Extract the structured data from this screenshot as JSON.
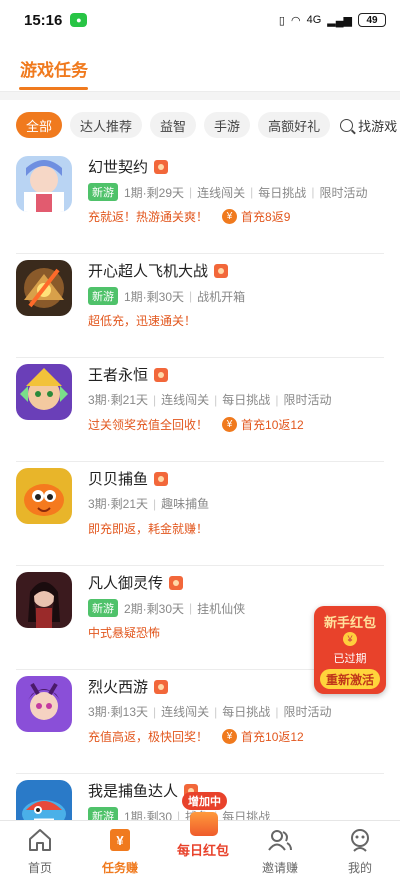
{
  "status_bar": {
    "time": "15:16",
    "wechat_icon": "wechat-icon",
    "network": "4G",
    "battery": "49"
  },
  "header": {
    "title": "游戏任务"
  },
  "filters": {
    "chips": [
      "全部",
      "达人推荐",
      "益智",
      "手游",
      "高额好礼"
    ],
    "active_index": 0,
    "search_label": "找游戏"
  },
  "games": [
    {
      "name": "幻世契约",
      "is_new": true,
      "new_label": "新游",
      "period": "1期·剩29天",
      "tags": [
        "连线闯关",
        "每日挑战",
        "限时活动"
      ],
      "promo": "充就返！热游通关爽！",
      "first_charge": "首充8返9"
    },
    {
      "name": "开心超人飞机大战",
      "is_new": true,
      "new_label": "新游",
      "period": "1期·剩30天",
      "tags": [
        "战机开箱"
      ],
      "promo": "超低充，迅速通关！",
      "first_charge": ""
    },
    {
      "name": "王者永恒",
      "is_new": false,
      "new_label": "",
      "period": "3期·剩21天",
      "tags": [
        "连线闯关",
        "每日挑战",
        "限时活动"
      ],
      "promo": "过关领奖充值全回收！",
      "first_charge": "首充10返12"
    },
    {
      "name": "贝贝捕鱼",
      "is_new": false,
      "new_label": "",
      "period": "3期·剩21天",
      "tags": [
        "趣味捕鱼"
      ],
      "promo": "即充即返，耗金就赚！",
      "first_charge": ""
    },
    {
      "name": "凡人御灵传",
      "is_new": true,
      "new_label": "新游",
      "period": "2期·剩30天",
      "tags": [
        "挂机仙侠"
      ],
      "promo": "中式悬疑恐怖",
      "first_charge": ""
    },
    {
      "name": "烈火西游",
      "is_new": false,
      "new_label": "",
      "period": "3期·剩13天",
      "tags": [
        "连线闯关",
        "每日挑战",
        "限时活动"
      ],
      "promo": "充值高返，极快回奖！",
      "first_charge": "首充10返12"
    },
    {
      "name": "我是捕鱼达人",
      "is_new": true,
      "new_label": "新游",
      "period": "1期·剩30",
      "tags": [
        "捕鱼",
        "每日挑战"
      ],
      "promo": "",
      "first_charge": ""
    }
  ],
  "redpacket": {
    "title": "新手红包",
    "status": "已过期",
    "button": "重新激活"
  },
  "tabbar": {
    "tabs": [
      {
        "label": "首页",
        "icon": "home-icon"
      },
      {
        "label": "任务赚",
        "icon": "task-yen-icon"
      },
      {
        "label": "每日红包",
        "icon": "red-envelope-icon"
      },
      {
        "label": "邀请赚",
        "icon": "invite-icon"
      },
      {
        "label": "我的",
        "icon": "profile-icon"
      }
    ],
    "active_index": 1,
    "daily_bubble": "增加中"
  },
  "colors": {
    "accent": "#f07a1e",
    "promo": "#e2571e",
    "new_tag": "#4fc26a",
    "red": "#e8422b"
  }
}
